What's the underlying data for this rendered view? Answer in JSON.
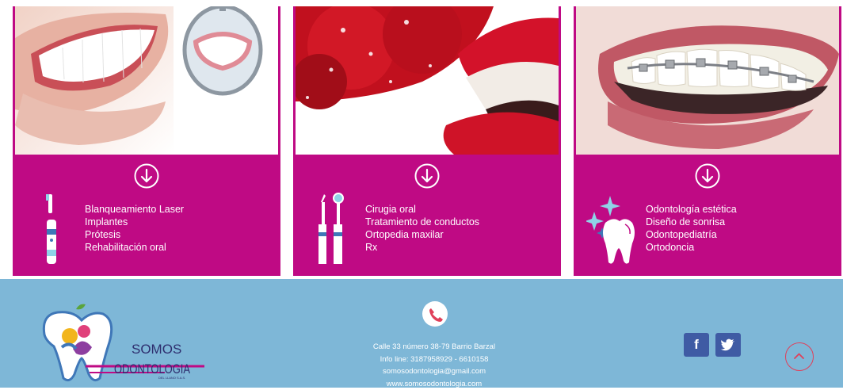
{
  "cards": [
    {
      "items": [
        "Blanqueamiento Laser",
        "Implantes",
        "Prótesis",
        "Rehabilitación oral"
      ],
      "tool_icon": "toothbrush-icon"
    },
    {
      "items": [
        "Cirugia oral",
        "Tratamiento de conductos",
        "Ortopedia maxilar",
        "Rx"
      ],
      "tool_icon": "dental-tools-icon"
    },
    {
      "items": [
        "Odontología estética",
        "Diseño de sonrisa",
        "Odontopediatría",
        "Ortodoncia"
      ],
      "tool_icon": "sparkling-tooth-icon"
    }
  ],
  "footer": {
    "logo": {
      "line1": "SOMOS",
      "line2": "ODONTOLOGIA",
      "line3": "DEL LLANO S.A.S."
    },
    "contact": {
      "address": "Calle 33 número 38-79 Barrio Barzal",
      "phone": "Info line: 3187958929 - 6610158",
      "email": "somosodontologia@gmail.com",
      "web": "www.somosodontologia.com"
    },
    "social": {
      "facebook": "f",
      "twitter": "twitter-icon"
    }
  },
  "colors": {
    "card_bg": "#bf0a84",
    "footer_bg": "#7eb7d7",
    "accent_blue": "#3f5ba4",
    "scroll_top": "#e0405a"
  }
}
